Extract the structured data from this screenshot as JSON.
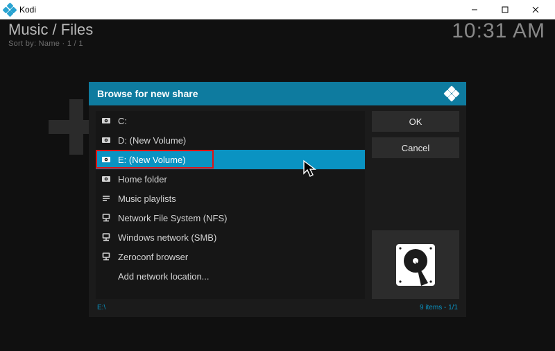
{
  "window": {
    "title": "Kodi"
  },
  "header": {
    "breadcrumb": "Music / Files",
    "sortline": "Sort by: Name  ·  1 / 1",
    "clock": "10:31 AM"
  },
  "dialog": {
    "title": "Browse for new share",
    "items": [
      {
        "icon": "drive",
        "label": "C:"
      },
      {
        "icon": "drive",
        "label": "D: (New Volume)"
      },
      {
        "icon": "drive",
        "label": "E: (New Volume)",
        "selected": true
      },
      {
        "icon": "drive",
        "label": "Home folder"
      },
      {
        "icon": "playlist",
        "label": "Music playlists"
      },
      {
        "icon": "network",
        "label": "Network File System (NFS)"
      },
      {
        "icon": "network",
        "label": "Windows network (SMB)"
      },
      {
        "icon": "network",
        "label": "Zeroconf browser"
      },
      {
        "icon": "none",
        "label": "Add network location..."
      }
    ],
    "ok": "OK",
    "cancel": "Cancel",
    "footer_path": "E:\\",
    "footer_count": "9 items - 1/1"
  }
}
